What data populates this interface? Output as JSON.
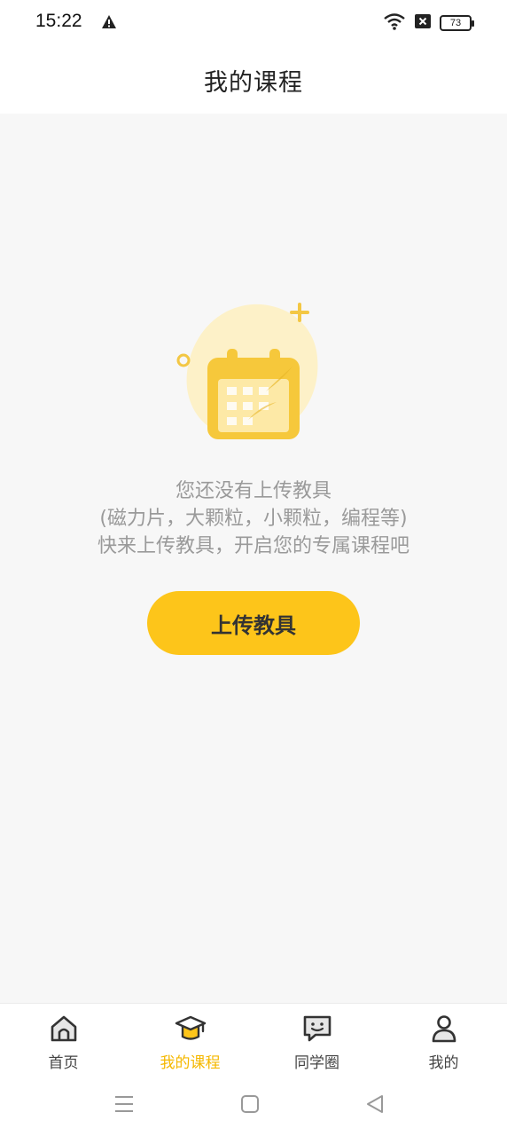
{
  "status_bar": {
    "time": "15:22",
    "battery_level": "73",
    "icons": [
      "warning-icon",
      "wifi-icon",
      "no-sim-icon",
      "battery-icon"
    ]
  },
  "header": {
    "title": "我的课程"
  },
  "empty_state": {
    "illustration": "calendar-icon",
    "line1": "您还没有上传教具",
    "line2": "(磁力片，大颗粒，小颗粒，编程等)",
    "line3": "快来上传教具，开启您的专属课程吧",
    "button_label": "上传教具"
  },
  "tab_bar": {
    "items": [
      {
        "label": "首页",
        "icon": "home-icon",
        "active": false
      },
      {
        "label": "我的课程",
        "icon": "graduation-cap-icon",
        "active": true
      },
      {
        "label": "同学圈",
        "icon": "chat-bubble-icon",
        "active": false
      },
      {
        "label": "我的",
        "icon": "person-icon",
        "active": false
      }
    ]
  },
  "system_nav": {
    "buttons": [
      "menu-icon",
      "home-square-icon",
      "back-triangle-icon"
    ]
  },
  "colors": {
    "accent": "#fdc51a",
    "active_tab": "#f5b800",
    "background": "#f7f7f7",
    "hint_text": "#9a9a9a"
  }
}
